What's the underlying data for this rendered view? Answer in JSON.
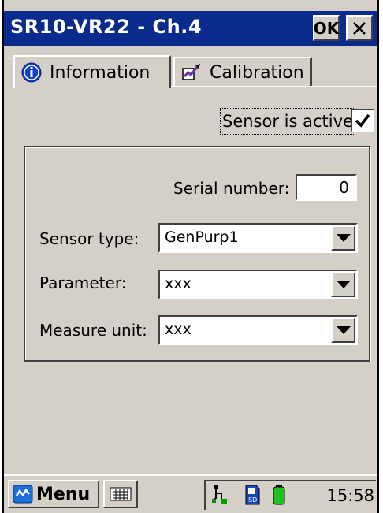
{
  "window": {
    "title": "SR10-VR22 - Ch.4",
    "ok_label": "OK"
  },
  "tabs": [
    {
      "label": "Information",
      "icon": "info-icon",
      "active": true
    },
    {
      "label": "Calibration",
      "icon": "calibration-icon",
      "active": false
    }
  ],
  "sensor_active": {
    "label": "Sensor is active",
    "checked": true
  },
  "fields": {
    "serial_label": "Serial number:",
    "serial_value": "0",
    "sensor_type_label": "Sensor type:",
    "sensor_type_value": "GenPurp1",
    "parameter_label": "Parameter:",
    "parameter_value": "xxx",
    "measure_unit_label": "Measure unit:",
    "measure_unit_value": "xxx"
  },
  "taskbar": {
    "menu_label": "Menu",
    "clock": "15:58",
    "tray_icons": [
      "network-icon",
      "sd-card-icon",
      "battery-icon"
    ]
  },
  "colors": {
    "titlebar": "#0b2a8e",
    "window_bg": "#d4d0c8"
  }
}
